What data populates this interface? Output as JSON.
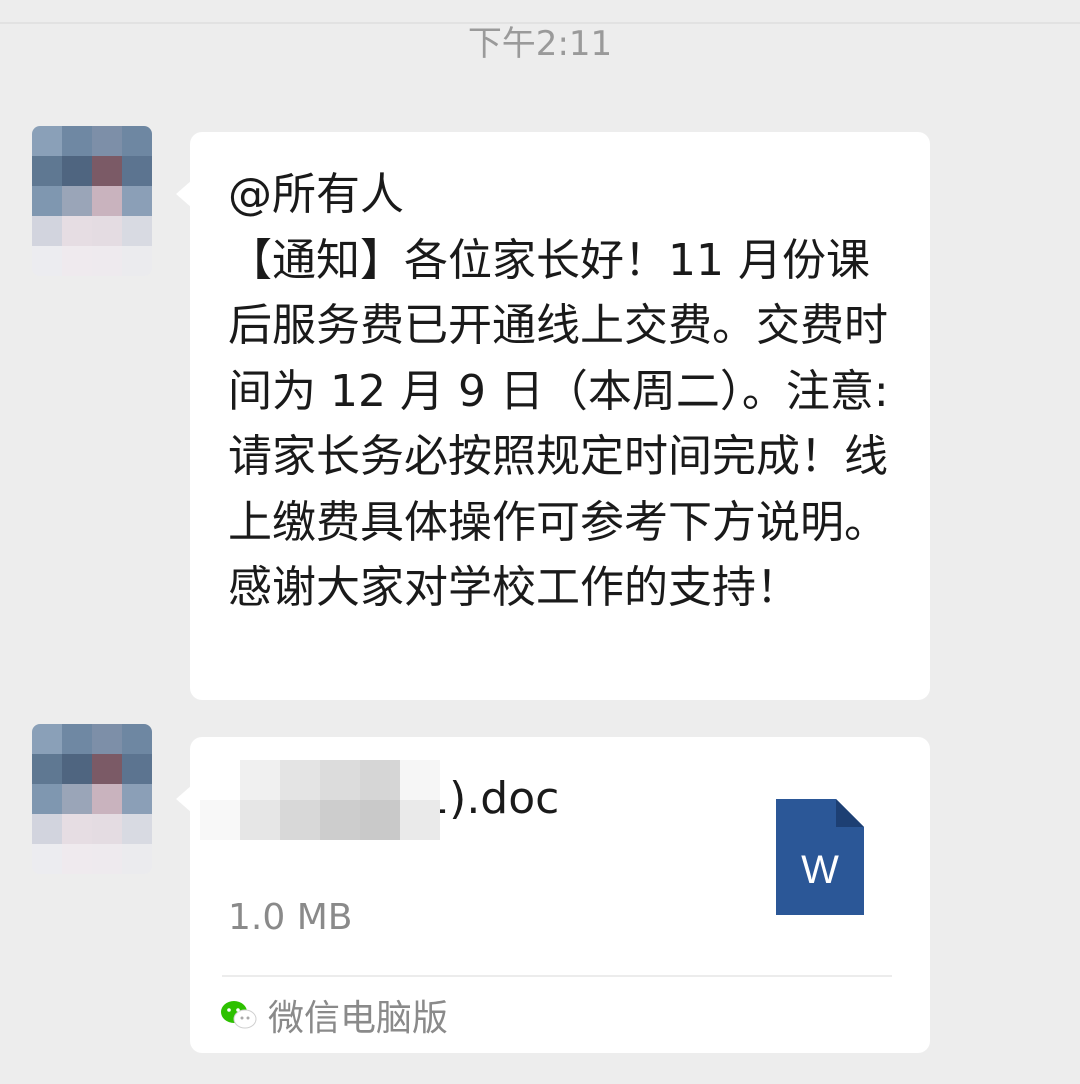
{
  "status": {
    "time": "下午2:11"
  },
  "messages": [
    {
      "type": "text",
      "text": "@所有人\n【通知】各位家长好！11 月份课后服务费已开通线上交费。交费时间为 12 月 9 日（本周二）。注意:请家长务必按照规定时间完成！线上缴费具体操作可参考下方说明。感谢大家对学校工作的支持！"
    },
    {
      "type": "file",
      "file_name": "缴费说明(1).doc",
      "file_size": "1.0 MB",
      "file_icon": "word-doc-icon",
      "file_icon_letter": "W",
      "source_label": "微信电脑版",
      "source_icon": "wechat-icon"
    }
  ],
  "colors": {
    "word_blue": "#2b5797",
    "wechat_green": "#2dc100"
  }
}
